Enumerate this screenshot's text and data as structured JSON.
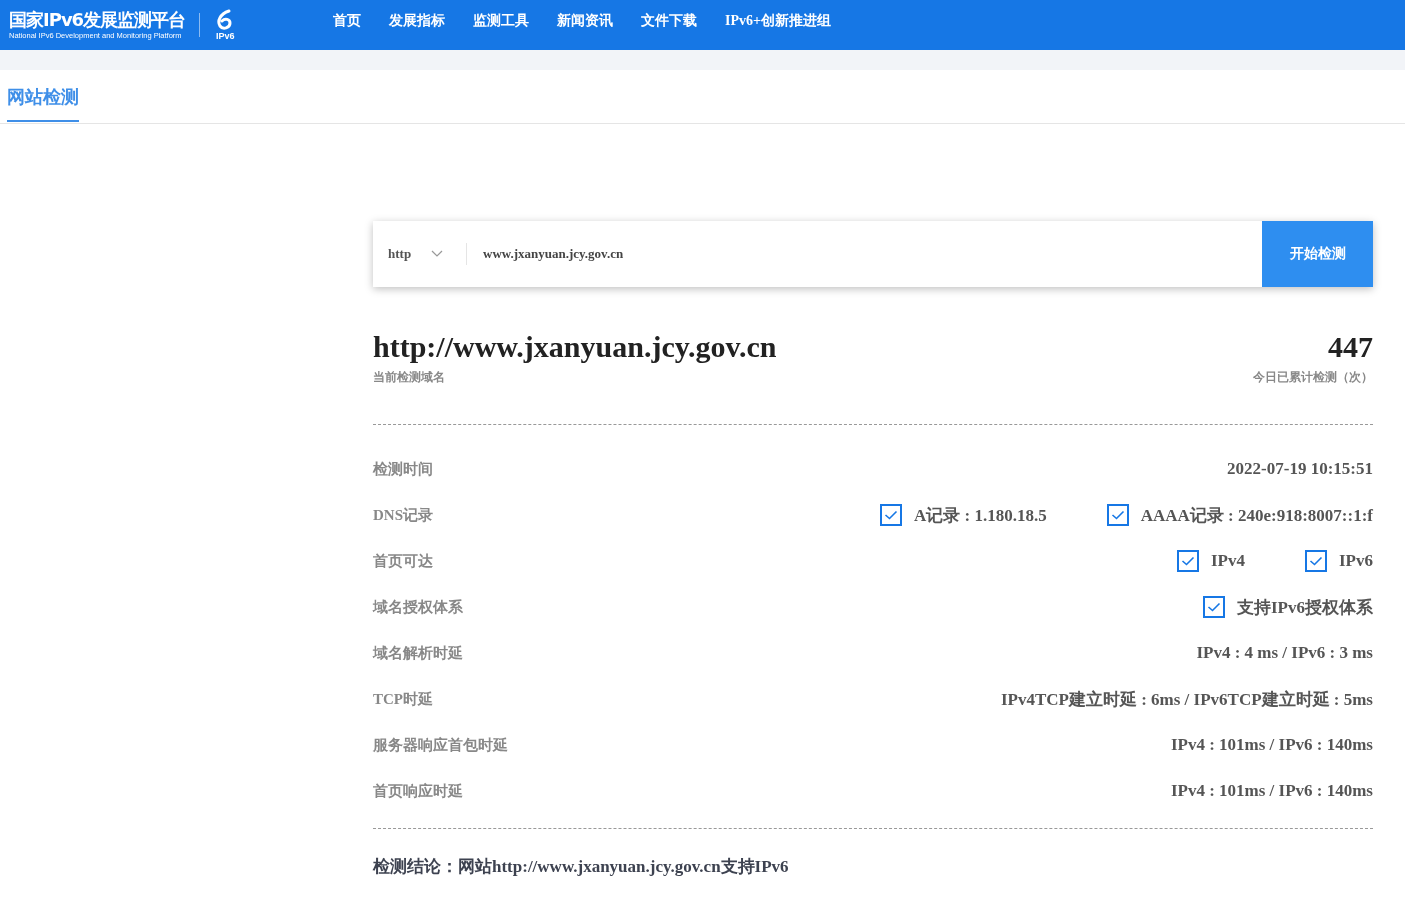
{
  "header": {
    "logo_title": "国家IPv6发展监测平台",
    "logo_subtitle": "National IPv6 Development and Monitoring Platform",
    "logo_badge": "IPv6",
    "nav": [
      {
        "label": "首页",
        "selected": false
      },
      {
        "label": "发展指标",
        "selected": false
      },
      {
        "label": "监测工具",
        "selected": false
      },
      {
        "label": "新闻资讯",
        "selected": false
      },
      {
        "label": "文件下载",
        "selected": false
      },
      {
        "label": "IPv6+创新推进组",
        "selected": false
      }
    ]
  },
  "tabs": [
    {
      "label": "网站检测",
      "selected": true
    }
  ],
  "search": {
    "protocol": "http",
    "value": "www.jxanyuan.jcy.gov.cn",
    "button": "开始检测"
  },
  "summary": {
    "domain": "http://www.jxanyuan.jcy.gov.cn",
    "domain_label": "当前检测域名",
    "count": "447",
    "count_label": "今日已累计检测（次）"
  },
  "results": [
    {
      "kind": "text",
      "label": "检测时间",
      "value": "2022-07-19 10:15:51"
    },
    {
      "kind": "checks",
      "label": "DNS记录",
      "checks": [
        {
          "label": "A记录 : 1.180.18.5",
          "checked": true
        },
        {
          "label": "AAAA记录 : 240e:918:8007::1:f",
          "checked": true
        }
      ]
    },
    {
      "kind": "checks",
      "label": "首页可达",
      "checks": [
        {
          "label": "IPv4",
          "checked": true
        },
        {
          "label": "IPv6",
          "checked": true
        }
      ]
    },
    {
      "kind": "checks",
      "label": "域名授权体系",
      "checks": [
        {
          "label": "支持IPv6授权体系",
          "checked": true
        }
      ]
    },
    {
      "kind": "text",
      "label": "域名解析时延",
      "value": "IPv4 : 4 ms / IPv6 : 3 ms"
    },
    {
      "kind": "text",
      "label": "TCP时延",
      "value": "IPv4TCP建立时延 : 6ms / IPv6TCP建立时延 : 5ms"
    },
    {
      "kind": "text",
      "label": "服务器响应首包时延",
      "value": "IPv4 : 101ms / IPv6 : 140ms"
    },
    {
      "kind": "text",
      "label": "首页响应时延",
      "value": "IPv4 : 101ms / IPv6 : 140ms"
    }
  ],
  "conclusion": "检测结论：网站http://www.jxanyuan.jcy.gov.cn支持IPv6"
}
